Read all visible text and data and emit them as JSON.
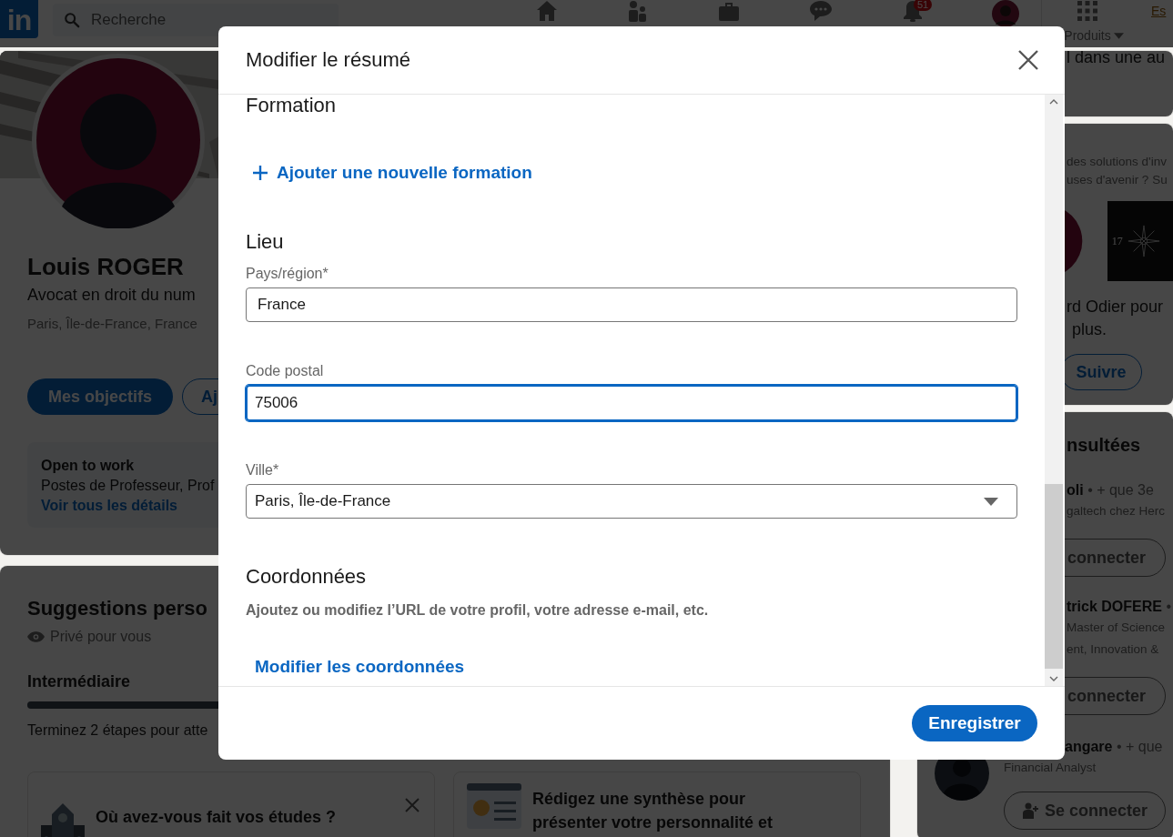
{
  "top_nav": {
    "logo": "in",
    "search": {
      "placeholder": "Recherche"
    },
    "notifications_badge": "51",
    "products_label": "Produits",
    "premium_link": "Es"
  },
  "profile": {
    "name": "Louis ROGER",
    "headline": "Avocat en droit du num",
    "location": "Paris, Île-de-France, France",
    "buttons": [
      {
        "label": "Mes objectifs",
        "kind": "primary"
      },
      {
        "label": "Aj",
        "kind": "outline"
      }
    ],
    "open_to_work": {
      "title": "Open to work",
      "roles": "Postes de Professeur, Prof",
      "link": "Voir tous les détails"
    }
  },
  "suggestions": {
    "title": "Suggestions perso",
    "privacy": "Privé pour vous",
    "level_label": "Intermédiaire",
    "level": 0.5,
    "hint": "Terminez 2 étapes pour atte",
    "cards": [
      {
        "kind": "school",
        "lines": [
          "Où avez-vous fait vos études ?"
        ],
        "dismissible": true
      },
      {
        "kind": "summary",
        "lines": [
          "Rédigez une synthèse pour",
          "présenter votre personnalité et"
        ],
        "dismissible": false
      }
    ]
  },
  "aside": {
    "ad_fragment": "l dans une au",
    "promo": {
      "lines": [
        "des solutions d'inv",
        "uses d'avenir ? Su"
      ],
      "logo_text": "17",
      "caption": [
        "rd Odier pour",
        "plus."
      ],
      "follow_button": "Suivre"
    },
    "viewed": {
      "title": "nsultées",
      "people": [
        {
          "kind": "clipped",
          "name": "oli",
          "degree": "• + que 3e",
          "subtitles": [
            "galtech chez Herc"
          ],
          "button": "connecter"
        },
        {
          "kind": "clipped",
          "name": "trick DOFERE",
          "degree": "•",
          "subtitles": [
            "Master of Science",
            "ent, Innovation &"
          ],
          "button": "connecter"
        },
        {
          "kind": "full",
          "name": "angare",
          "degree": "• + que",
          "subtitles": [
            "Financial Analyst"
          ],
          "button": "Se connecter"
        }
      ]
    }
  },
  "modal": {
    "title": "Modifier le résumé",
    "sections": [
      {
        "heading": "Formation",
        "items": [
          {
            "kind": "add_link",
            "label": "Ajouter une nouvelle formation"
          }
        ]
      },
      {
        "heading": "Lieu",
        "items": [
          {
            "kind": "text",
            "label": "Pays/région*",
            "value": "France",
            "focused": false
          },
          {
            "kind": "text",
            "label": "Code postal",
            "value": "75006",
            "focused": true
          },
          {
            "kind": "select",
            "label": "Ville*",
            "value": "Paris, Île-de-France",
            "focused": false
          }
        ]
      },
      {
        "heading": "Coordonnées",
        "items": [
          {
            "kind": "note",
            "text": "Ajoutez ou modifiez l’URL de votre profil, votre adresse e-mail, etc."
          },
          {
            "kind": "link",
            "label": "Modifier les coordonnées"
          }
        ]
      }
    ],
    "save_button": "Enregistrer"
  }
}
